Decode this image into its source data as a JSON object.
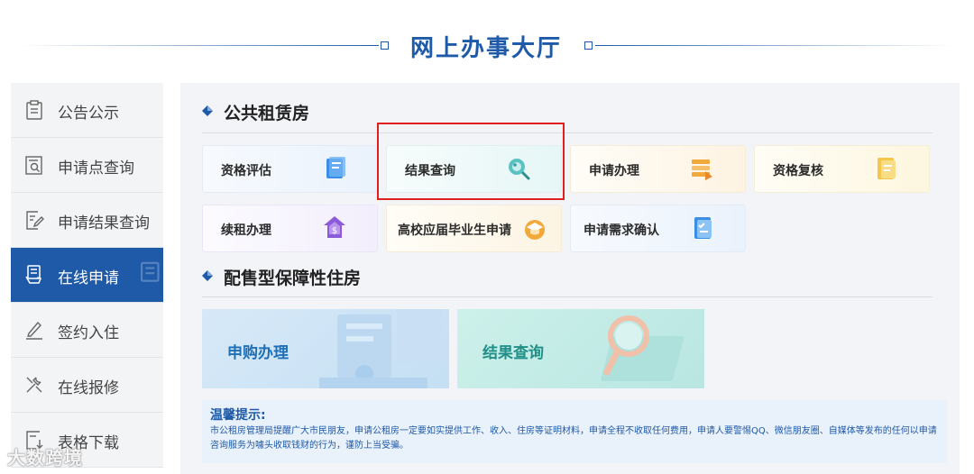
{
  "header": {
    "title": "网上办事大厅"
  },
  "sidebar": {
    "items": [
      {
        "label": "公告公示",
        "icon": "clipboard-icon"
      },
      {
        "label": "申请点查询",
        "icon": "search-doc-icon"
      },
      {
        "label": "申请结果查询",
        "icon": "edit-doc-icon"
      },
      {
        "label": "在线申请",
        "icon": "hand-doc-icon",
        "active": true
      },
      {
        "label": "签约入住",
        "icon": "pen-sign-icon"
      },
      {
        "label": "在线报修",
        "icon": "wrench-icon"
      },
      {
        "label": "表格下载",
        "icon": "download-doc-icon"
      }
    ]
  },
  "public_rental": {
    "title": "公共租赁房",
    "cards": [
      {
        "label": "资格评估",
        "icon": "document-icon"
      },
      {
        "label": "结果查询",
        "icon": "magnifier-icon"
      },
      {
        "label": "申请办理",
        "icon": "files-icon"
      },
      {
        "label": "资格复核",
        "icon": "review-doc-icon"
      },
      {
        "label": "续租办理",
        "icon": "house-money-icon"
      },
      {
        "label": "高校应届毕业生申请",
        "icon": "graduate-cap-icon"
      },
      {
        "label": "申请需求确认",
        "icon": "checklist-icon"
      }
    ]
  },
  "sale_housing": {
    "title": "配售型保障性住房",
    "cards": [
      {
        "label": "申购办理"
      },
      {
        "label": "结果查询"
      }
    ]
  },
  "tip": {
    "title": "温馨提示:",
    "text": "市公租房管理局提醒广大市民朋友，申请公租房一定要如实提供工作、收入、住房等证明材料，申请全程不收取任何费用，申请人要警惕QQ、微信朋友圈、自媒体等发布的任何以申请咨询服务为噱头收取钱财的行为，谨防上当受骗。"
  },
  "watermark": "大数跨境",
  "colors": {
    "primary": "#1e5aa8",
    "highlight": "#e02020"
  }
}
